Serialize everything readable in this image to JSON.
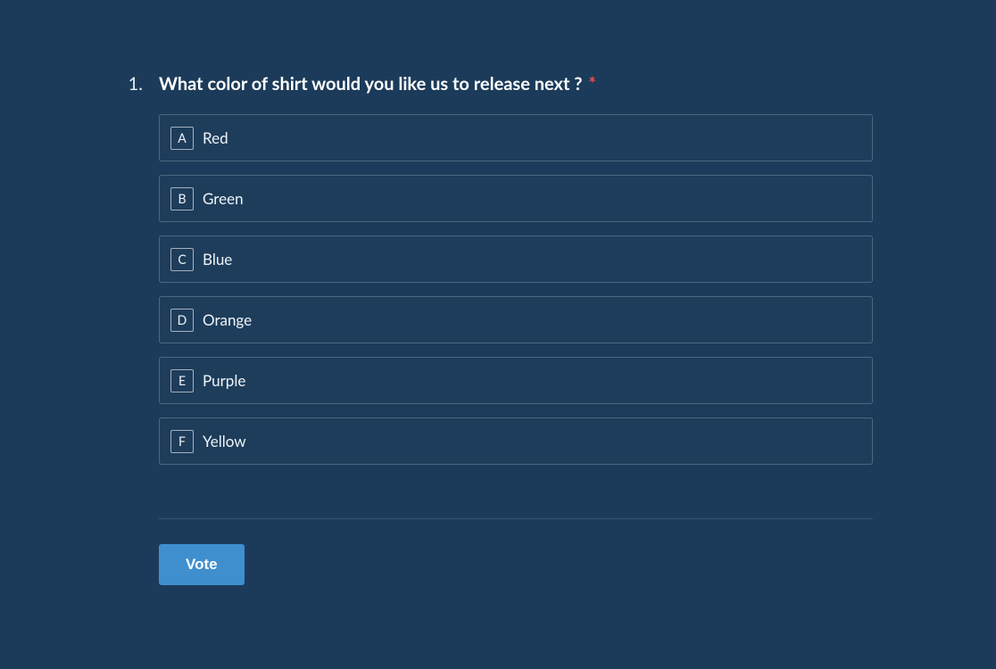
{
  "question": {
    "number": "1.",
    "text": "What color of shirt would you like us to release next ?",
    "required_mark": "*"
  },
  "options": [
    {
      "letter": "A",
      "label": "Red"
    },
    {
      "letter": "B",
      "label": "Green"
    },
    {
      "letter": "C",
      "label": "Blue"
    },
    {
      "letter": "D",
      "label": "Orange"
    },
    {
      "letter": "E",
      "label": "Purple"
    },
    {
      "letter": "F",
      "label": "Yellow"
    }
  ],
  "actions": {
    "vote_label": "Vote"
  },
  "colors": {
    "background": "#1c3b5a",
    "accent": "#3f8fcf",
    "required": "#e55353"
  }
}
